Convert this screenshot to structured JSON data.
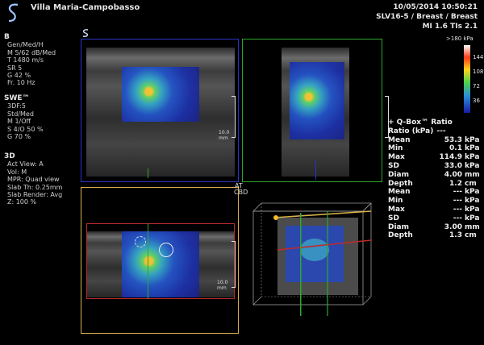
{
  "header": {
    "site": "Villa Maria-Campobasso",
    "datetime": "10/05/2014 10:50:21",
    "probe": "SLV16-5 / Breast / Breast",
    "indices": "MI 1.6  TIs  2.1"
  },
  "sidebar": {
    "b": {
      "title": "B",
      "lines": [
        "Gen/Med/H",
        "M 5/62 dB/Med",
        "T 1480 m/s",
        "SR 5",
        "G 42 %",
        "Fr. 10 Hz"
      ]
    },
    "swe": {
      "title": "SWE™",
      "lines": [
        "3DF:5",
        "Std/Med",
        "M 1/Off",
        "S 4/O 50 %",
        "G 70 %"
      ]
    },
    "d3": {
      "title": "3D",
      "lines": [
        "Act View: A",
        "Vol: M",
        "MPR: Quad view",
        "Slab Th: 0.25mm",
        "Slab Render: Avg",
        "Z: 100 %"
      ]
    }
  },
  "colorbar": {
    "top": ">180 kPa",
    "ticks": [
      "144",
      "108",
      "72",
      "36"
    ]
  },
  "markers": {
    "at": "AT",
    "cbd": "CBD",
    "depth1": "10.0 mm",
    "depth2": "10.0 mm"
  },
  "qbox": {
    "title": "+ Q-Box™ Ratio",
    "ratio": "Ratio (kPa)",
    "ratio_val": "---",
    "rows1": [
      {
        "k": "Mean",
        "n": "53.3",
        "u": "kPa"
      },
      {
        "k": "Min",
        "n": "0.1",
        "u": "kPa"
      },
      {
        "k": "Max",
        "n": "114.9",
        "u": "kPa"
      },
      {
        "k": "SD",
        "n": "33.0",
        "u": "kPa"
      },
      {
        "k": "Diam",
        "n": "4.00",
        "u": "mm"
      },
      {
        "k": "Depth",
        "n": "1.2",
        "u": "cm"
      }
    ],
    "rows2": [
      {
        "k": "Mean",
        "n": "---",
        "u": "kPa"
      },
      {
        "k": "Min",
        "n": "---",
        "u": "kPa"
      },
      {
        "k": "Max",
        "n": "---",
        "u": "kPa"
      },
      {
        "k": "SD",
        "n": "---",
        "u": "kPa"
      },
      {
        "k": "Diam",
        "n": "3.00",
        "u": "mm"
      },
      {
        "k": "Depth",
        "n": "1.3",
        "u": "cm"
      }
    ]
  },
  "colors": {
    "blue_frame": "#2a34c8",
    "green_frame": "#2ea82e",
    "yellow_frame": "#d8b24a",
    "red_frame": "#c02a2a"
  }
}
